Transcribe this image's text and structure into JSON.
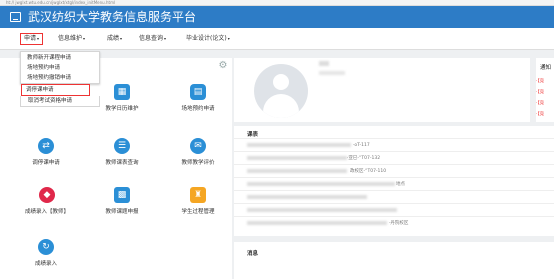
{
  "browser": {
    "url": "ht:// jwglxt.wtu.edu.cn/jwglxt/xtgl/index_initMenu.html"
  },
  "header": {
    "title": "武汉纺织大学教务信息服务平台"
  },
  "nav": [
    {
      "label": "申请"
    },
    {
      "label": "信息维护"
    },
    {
      "label": "成绩"
    },
    {
      "label": "信息查询"
    },
    {
      "label": "毕业设计(论文)"
    }
  ],
  "dropdown": {
    "items": [
      "教师新开课程申请",
      "场地预约申请",
      "场地预约撤销申请",
      "调停课申请",
      "取消考试资格申请"
    ],
    "highlighted_index": 3
  },
  "tiles": [
    {
      "label": "教学日历维护",
      "icon": "calendar-icon",
      "color": "#2b8fd6"
    },
    {
      "label": "场地预约申请",
      "icon": "document-icon",
      "color": "#2b8fd6"
    },
    {
      "label": "调停课申请",
      "icon": "exchange-icon",
      "color": "#2b8fd6"
    },
    {
      "label": "教师课表查询",
      "icon": "schedule-icon",
      "color": "#2b8fd6"
    },
    {
      "label": "教师教学评价",
      "icon": "evaluation-icon",
      "color": "#2b8fd6"
    },
    {
      "label": "成绩录入【教师】",
      "icon": "grade-entry-icon",
      "color": "#e0284a"
    },
    {
      "label": "教师课题申报",
      "icon": "project-icon",
      "color": "#2b8fd6"
    },
    {
      "label": "学生过程管理",
      "icon": "student-management-icon",
      "color": "#f5a623"
    },
    {
      "label": "成绩录入",
      "icon": "grade-icon",
      "color": "#2b8fd6"
    }
  ],
  "profile": {
    "notice_title": "通知",
    "notice_items": [
      "【竞",
      "【竞",
      "【竞",
      "【竞"
    ]
  },
  "courses": {
    "title": "课表",
    "rows": [
      "·oT-117",
      "·亚巳-“T07-132",
      "政校区-“T07-110",
      "地点",
      "",
      "",
      "·丹院校区"
    ]
  },
  "messages": {
    "title": "消息"
  }
}
